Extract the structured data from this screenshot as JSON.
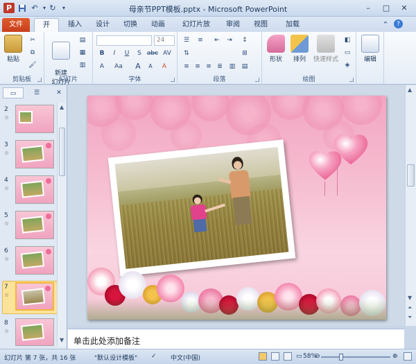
{
  "window": {
    "title": "母亲节PPT模板.pptx - Microsoft PowerPoint",
    "min_symbol": "–",
    "max_symbol": "□",
    "close_symbol": "✕"
  },
  "quick_access": {
    "save_icon": "save-icon",
    "undo_icon": "undo-icon",
    "redo_icon": "redo-icon"
  },
  "tabs": [
    {
      "label": "文件"
    },
    {
      "label": "开始"
    },
    {
      "label": "插入"
    },
    {
      "label": "设计"
    },
    {
      "label": "切换"
    },
    {
      "label": "动画"
    },
    {
      "label": "幻灯片放映"
    },
    {
      "label": "审阅"
    },
    {
      "label": "视图"
    },
    {
      "label": "加载项"
    }
  ],
  "ribbon": {
    "clipboard": {
      "label": "剪贴板",
      "paste": "粘贴"
    },
    "slides": {
      "label": "幻灯片",
      "new_slide": "新建\n幻灯片"
    },
    "font": {
      "label": "字体",
      "font_size": "24",
      "bold": "B",
      "italic": "I",
      "underline": "U",
      "strike": "S",
      "shadow": "abc",
      "spacing": "AV",
      "case": "Aa",
      "grow": "A",
      "shrink": "A",
      "clear": "A"
    },
    "paragraph": {
      "label": "段落"
    },
    "drawing": {
      "label": "绘图",
      "shapes": "形状",
      "arrange": "排列",
      "quick_styles": "快速样式"
    },
    "editing": {
      "label": "编辑",
      "edit": "编辑"
    }
  },
  "slides": [
    {
      "num": "2"
    },
    {
      "num": "3"
    },
    {
      "num": "4"
    },
    {
      "num": "5"
    },
    {
      "num": "6"
    },
    {
      "num": "7"
    },
    {
      "num": "8"
    }
  ],
  "notes_placeholder": "单击此处添加备注",
  "status": {
    "slide_info": "幻灯片 第 7 张，共 16 张",
    "theme": "\"默认设计模板\"",
    "language": "中文(中国)",
    "zoom": "58%",
    "zoom_fraction": 0.58
  },
  "colors": {
    "file_tab": "#d24726",
    "selected_slide": "#f3b53e"
  }
}
